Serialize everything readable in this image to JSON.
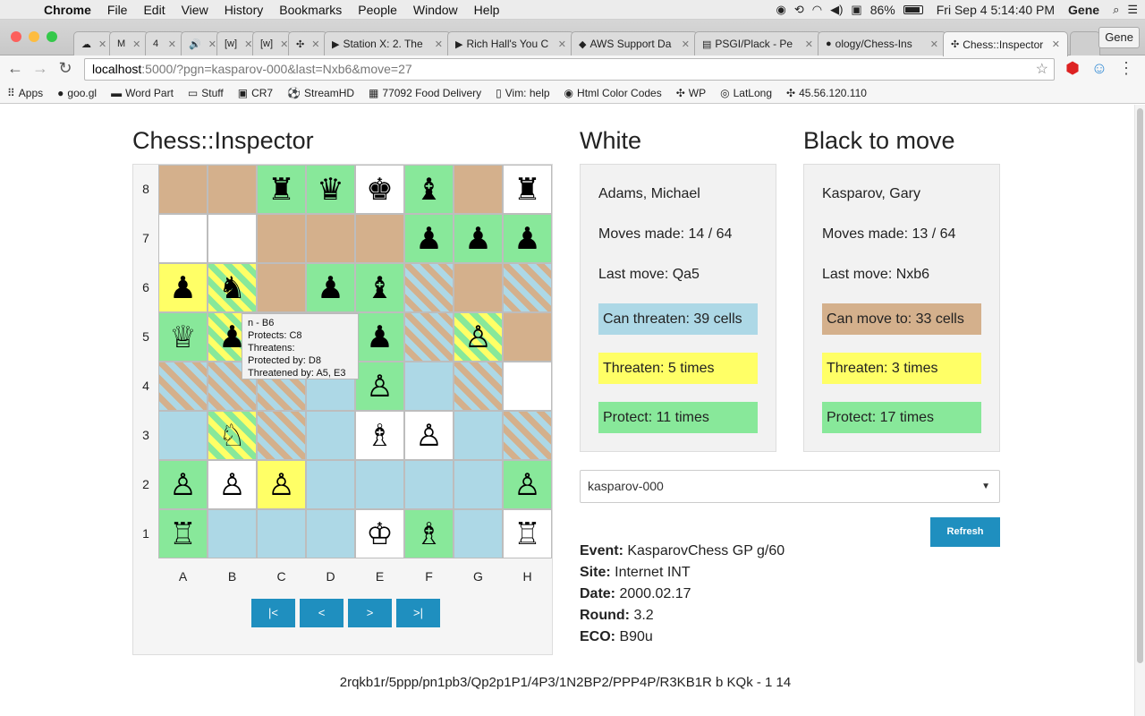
{
  "menubar": {
    "app": "Chrome",
    "items": [
      "File",
      "Edit",
      "View",
      "History",
      "Bookmarks",
      "People",
      "Window",
      "Help"
    ],
    "battery": "86%",
    "clock": "Fri Sep 4  5:14:40 PM",
    "user": "Gene"
  },
  "tabs": [
    {
      "label": "",
      "icon": "☁"
    },
    {
      "label": "",
      "icon": "M"
    },
    {
      "label": "",
      "icon": "4"
    },
    {
      "label": "",
      "icon": "🔊"
    },
    {
      "label": "",
      "icon": "[w]"
    },
    {
      "label": "",
      "icon": "[w]"
    },
    {
      "label": "",
      "icon": "✣"
    },
    {
      "label": "Station X: 2. The",
      "icon": "▶"
    },
    {
      "label": "Rich Hall's You C",
      "icon": "▶"
    },
    {
      "label": "AWS Support Da",
      "icon": "◆"
    },
    {
      "label": "PSGI/Plack - Pe",
      "icon": "▤"
    },
    {
      "label": "ology/Chess-Ins",
      "icon": "●"
    },
    {
      "label": "Chess::Inspector",
      "icon": "✣"
    }
  ],
  "profile": "Gene",
  "toolbar": {
    "url_host": "localhost",
    "url_path": ":5000/?pgn=kasparov-000&last=Nxb6&move=27"
  },
  "bookmarks": [
    {
      "label": "Apps",
      "icon": "⠿"
    },
    {
      "label": "goo.gl",
      "icon": "●"
    },
    {
      "label": "Word Part",
      "icon": "▬"
    },
    {
      "label": "Stuff",
      "icon": "▭"
    },
    {
      "label": "CR7",
      "icon": "▣"
    },
    {
      "label": "StreamHD",
      "icon": "⚽"
    },
    {
      "label": "77092 Food Delivery",
      "icon": "▦"
    },
    {
      "label": "Vim: help",
      "icon": "▯"
    },
    {
      "label": "Html Color Codes",
      "icon": "◉"
    },
    {
      "label": "WP",
      "icon": "✣"
    },
    {
      "label": "LatLong",
      "icon": "◎"
    },
    {
      "label": "45.56.120.110",
      "icon": "✣"
    }
  ],
  "page": {
    "title": "Chess::Inspector",
    "white_heading": "White",
    "black_heading": "Black to move",
    "ranks": [
      "8",
      "7",
      "6",
      "5",
      "4",
      "3",
      "2",
      "1"
    ],
    "files": [
      "A",
      "B",
      "C",
      "D",
      "E",
      "F",
      "G",
      "H"
    ],
    "colors": {
      "threaten": "#ffff66",
      "protect": "#88e89a",
      "can_threaten": "#add8e6",
      "can_move": "#d4b08c",
      "button": "#1f8fbf"
    },
    "board": [
      [
        {
          "c": "tan",
          "p": ""
        },
        {
          "c": "tan",
          "p": ""
        },
        {
          "c": "green",
          "p": "♜"
        },
        {
          "c": "green",
          "p": "♛"
        },
        {
          "c": "white",
          "p": "♚"
        },
        {
          "c": "green",
          "p": "♝"
        },
        {
          "c": "tan",
          "p": ""
        },
        {
          "c": "white",
          "p": "♜"
        }
      ],
      [
        {
          "c": "white",
          "p": ""
        },
        {
          "c": "white",
          "p": ""
        },
        {
          "c": "tan",
          "p": ""
        },
        {
          "c": "tan",
          "p": ""
        },
        {
          "c": "tan",
          "p": ""
        },
        {
          "c": "green",
          "p": "♟"
        },
        {
          "c": "green",
          "p": "♟"
        },
        {
          "c": "green",
          "p": "♟"
        }
      ],
      [
        {
          "c": "yellow",
          "p": "♟"
        },
        {
          "c": "yellow-green",
          "p": "♞"
        },
        {
          "c": "tan",
          "p": ""
        },
        {
          "c": "green",
          "p": "♟"
        },
        {
          "c": "green",
          "p": "♝"
        },
        {
          "c": "blue-tan",
          "p": ""
        },
        {
          "c": "tan",
          "p": ""
        },
        {
          "c": "blue-tan",
          "p": ""
        }
      ],
      [
        {
          "c": "green",
          "p": "♕"
        },
        {
          "c": "yellow-green",
          "p": "♟"
        },
        {
          "c": "tan",
          "p": ""
        },
        {
          "c": "tan",
          "p": ""
        },
        {
          "c": "green",
          "p": "♟"
        },
        {
          "c": "blue-tan",
          "p": ""
        },
        {
          "c": "yellow-green",
          "p": "♙"
        },
        {
          "c": "tan",
          "p": ""
        }
      ],
      [
        {
          "c": "blue-tan",
          "p": ""
        },
        {
          "c": "blue-tan",
          "p": ""
        },
        {
          "c": "blue-tan",
          "p": ""
        },
        {
          "c": "blue",
          "p": ""
        },
        {
          "c": "green",
          "p": "♙"
        },
        {
          "c": "blue",
          "p": ""
        },
        {
          "c": "blue-tan",
          "p": ""
        },
        {
          "c": "white",
          "p": ""
        }
      ],
      [
        {
          "c": "blue",
          "p": ""
        },
        {
          "c": "yellow-green",
          "p": "♘"
        },
        {
          "c": "blue-tan",
          "p": ""
        },
        {
          "c": "blue",
          "p": ""
        },
        {
          "c": "white",
          "p": "♗"
        },
        {
          "c": "white",
          "p": "♙"
        },
        {
          "c": "blue",
          "p": ""
        },
        {
          "c": "blue-tan",
          "p": ""
        }
      ],
      [
        {
          "c": "green",
          "p": "♙"
        },
        {
          "c": "white",
          "p": "♙"
        },
        {
          "c": "yellow",
          "p": "♙"
        },
        {
          "c": "blue",
          "p": ""
        },
        {
          "c": "blue",
          "p": ""
        },
        {
          "c": "blue",
          "p": ""
        },
        {
          "c": "blue",
          "p": ""
        },
        {
          "c": "green",
          "p": "♙"
        }
      ],
      [
        {
          "c": "green",
          "p": "♖"
        },
        {
          "c": "blue",
          "p": ""
        },
        {
          "c": "blue",
          "p": ""
        },
        {
          "c": "blue",
          "p": ""
        },
        {
          "c": "white",
          "p": "♔"
        },
        {
          "c": "green",
          "p": "♗"
        },
        {
          "c": "blue",
          "p": ""
        },
        {
          "c": "white",
          "p": "♖"
        }
      ]
    ],
    "tooltip": {
      "line1": "n - B6",
      "line2": "Protects: C8",
      "line3": "Threatens:",
      "line4": "Protected by: D8",
      "line5": "Threatened by: A5, E3"
    },
    "nav": {
      "first": "|<",
      "prev": "<",
      "next": ">",
      "last": ">|"
    },
    "white": {
      "name": "Adams, Michael",
      "moves": "Moves made: 14 / 64",
      "last": "Last move: Qa5",
      "hl1": "Can threaten: 39 cells",
      "hl2": "Threaten: 5 times",
      "hl3": "Protect: 11 times"
    },
    "black": {
      "name": "Kasparov, Gary",
      "moves": "Moves made: 13 / 64",
      "last": "Last move: Nxb6",
      "hl1": "Can move to: 33 cells",
      "hl2": "Threaten: 3 times",
      "hl3": "Protect: 17 times"
    },
    "select_value": "kasparov-000",
    "refresh": "Refresh",
    "info": {
      "event_label": "Event:",
      "event": "KasparovChess GP g/60",
      "site_label": "Site:",
      "site": "Internet INT",
      "date_label": "Date:",
      "date": "2000.02.17",
      "round_label": "Round:",
      "round": "3.2",
      "eco_label": "ECO:",
      "eco": "B90u"
    },
    "fen": "2rqkb1r/5ppp/pn1pb3/Qp2p1P1/4P3/1N2BP2/PPP4P/R3KB1R b KQk - 1 14"
  }
}
